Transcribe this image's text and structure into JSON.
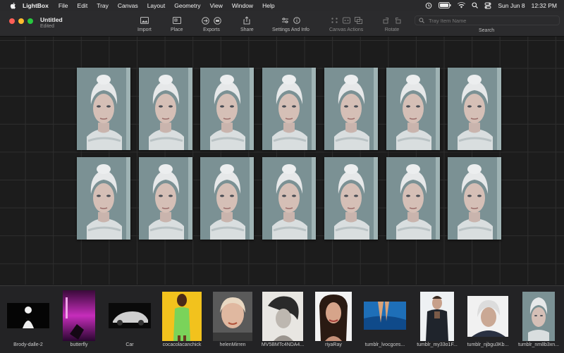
{
  "menubar": {
    "app_name": "LightBox",
    "items": [
      "File",
      "Edit",
      "Tray",
      "Canvas",
      "Layout",
      "Geometry",
      "View",
      "Window",
      "Help"
    ],
    "date": "Sun Jun 8",
    "time": "12:32 PM"
  },
  "window": {
    "title": "Untitled",
    "subtitle": "Edited"
  },
  "toolbar": {
    "import": "Import",
    "place": "Place",
    "exports": "Exports",
    "share": "Share",
    "settings": "Settings And Info",
    "canvas_actions": "Canvas Actions",
    "rotate": "Rotate",
    "search_label": "Search",
    "search_placeholder": "Tray Item Name"
  },
  "canvas": {
    "rows": 2,
    "columns": 7,
    "photo_count": 14
  },
  "tray": {
    "items": [
      {
        "label": "Brody-dalle-2"
      },
      {
        "label": "butterfly"
      },
      {
        "label": "Car"
      },
      {
        "label": "cocacolacanchick"
      },
      {
        "label": "helenMirren"
      },
      {
        "label": "MV5BMTc4NDA4..."
      },
      {
        "label": "riyaRay"
      },
      {
        "label": "tumblr_lvocgces..."
      },
      {
        "label": "tumblr_my33o1F..."
      },
      {
        "label": "tumblr_njbgu3Kb..."
      },
      {
        "label": "tumblr_nm8b3xn..."
      }
    ]
  },
  "colors": {
    "close": "#ff5f57",
    "minimize": "#febc2e",
    "zoom": "#28c840",
    "canvas_bg": "#1c1c1c",
    "tray_bg": "#232325"
  }
}
